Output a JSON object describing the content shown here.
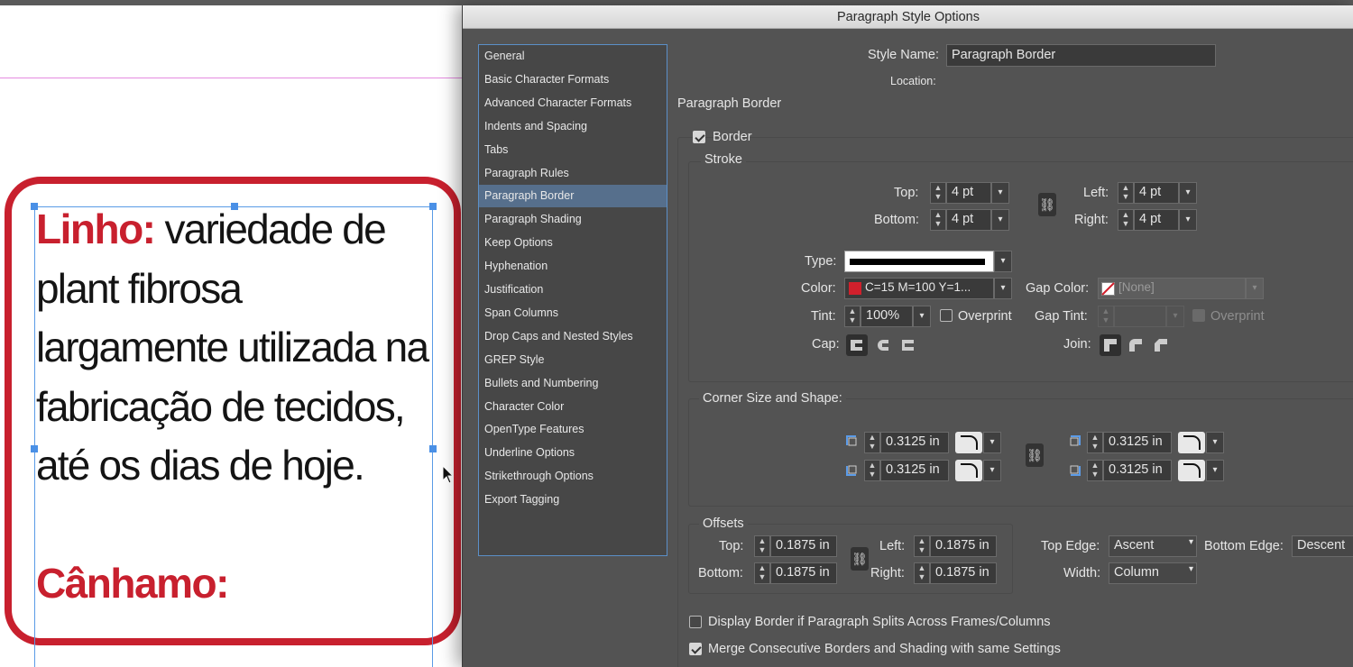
{
  "document": {
    "story_term1": "Linho:",
    "story_body": " variedade de plant fibrosa largamente utilizada na fabricação de tecidos, até os dias de hoje.",
    "story_term2": "Cânhamo:",
    "accent_color": "#c8202e"
  },
  "dialog": {
    "title": "Paragraph Style Options",
    "categories": [
      "General",
      "Basic Character Formats",
      "Advanced Character Formats",
      "Indents and Spacing",
      "Tabs",
      "Paragraph Rules",
      "Paragraph Border",
      "Paragraph Shading",
      "Keep Options",
      "Hyphenation",
      "Justification",
      "Span Columns",
      "Drop Caps and Nested Styles",
      "GREP Style",
      "Bullets and Numbering",
      "Character Color",
      "OpenType Features",
      "Underline Options",
      "Strikethrough Options",
      "Export Tagging"
    ],
    "selected_category": "Paragraph Border",
    "style_name_label": "Style Name:",
    "style_name_value": "Paragraph Border",
    "location_label": "Location:",
    "section_title": "Paragraph Border",
    "border_label": "Border",
    "border_checked": true,
    "stroke": {
      "title": "Stroke",
      "top_label": "Top:",
      "top_value": "4 pt",
      "bottom_label": "Bottom:",
      "bottom_value": "4 pt",
      "left_label": "Left:",
      "left_value": "4 pt",
      "right_label": "Right:",
      "right_value": "4 pt",
      "type_label": "Type:",
      "color_label": "Color:",
      "color_value": "C=15 M=100 Y=1...",
      "color_swatch": "#d1202c",
      "gap_color_label": "Gap Color:",
      "gap_color_value": "[None]",
      "tint_label": "Tint:",
      "tint_value": "100%",
      "overprint_label": "Overprint",
      "gap_tint_label": "Gap Tint:",
      "gap_overprint_label": "Overprint",
      "cap_label": "Cap:",
      "join_label": "Join:"
    },
    "corner": {
      "title": "Corner Size and Shape:",
      "tl_value": "0.3125 in",
      "bl_value": "0.3125 in",
      "tr_value": "0.3125 in",
      "br_value": "0.3125 in"
    },
    "offsets": {
      "title": "Offsets",
      "top_label": "Top:",
      "top_value": "0.1875 in",
      "bottom_label": "Bottom:",
      "bottom_value": "0.1875 in",
      "left_label": "Left:",
      "left_value": "0.1875 in",
      "right_label": "Right:",
      "right_value": "0.1875 in",
      "top_edge_label": "Top Edge:",
      "top_edge_value": "Ascent",
      "bottom_edge_label": "Bottom Edge:",
      "bottom_edge_value": "Descent",
      "width_label": "Width:",
      "width_value": "Column"
    },
    "display_border_label": "Display Border if Paragraph Splits Across Frames/Columns",
    "display_border_checked": false,
    "merge_label": "Merge Consecutive Borders and Shading with same Settings",
    "merge_checked": true
  }
}
